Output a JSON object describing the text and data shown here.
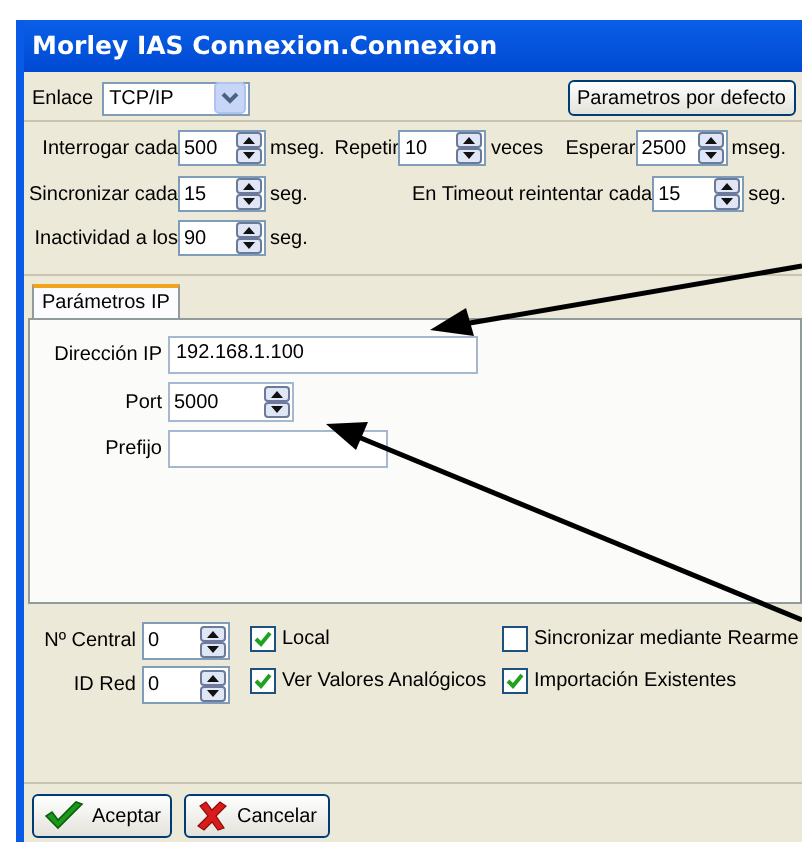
{
  "window": {
    "title": "Morley IAS Connexion.Connexion"
  },
  "link": {
    "label": "Enlace",
    "value": "TCP/IP"
  },
  "default_button": "Parametros por defecto",
  "timing": [
    [
      {
        "label": "Interrogar cada",
        "value": "500",
        "unit": "mseg."
      },
      {
        "label": "Repetir",
        "value": "10",
        "unit": "veces"
      },
      {
        "label": "Esperar",
        "value": "2500",
        "unit": "mseg."
      }
    ],
    [
      {
        "label": "Sincronizar cada",
        "value": "15",
        "unit": "seg."
      },
      {
        "label": "En Timeout reintentar cada",
        "value": "15",
        "unit": "seg."
      }
    ],
    [
      {
        "label": "Inactividad a los",
        "value": "90",
        "unit": "seg."
      }
    ]
  ],
  "tabs": [
    {
      "label": "Parámetros IP",
      "selected": true
    }
  ],
  "ip_fields": [
    {
      "label": "Dirección IP",
      "value": "192.168.1.100",
      "kind": "text"
    },
    {
      "label": "Port",
      "value": "5000",
      "kind": "spin"
    },
    {
      "label": "Prefijo",
      "kind": "text"
    }
  ],
  "station_fields": [
    {
      "label": "Nº Central",
      "value": "0"
    },
    {
      "label": "ID Red",
      "value": "0"
    }
  ],
  "options": [
    {
      "label": "Local",
      "checked": true
    },
    {
      "label": "Sincronizar mediante Rearme",
      "checked": false
    },
    {
      "label": "Ver Valores Analógicos",
      "checked": true
    },
    {
      "label": "Importación Existentes",
      "checked": true
    }
  ],
  "buttons": [
    {
      "label": "Aceptar",
      "kind": "ok"
    },
    {
      "label": "Cancelar",
      "kind": "cancel"
    }
  ]
}
